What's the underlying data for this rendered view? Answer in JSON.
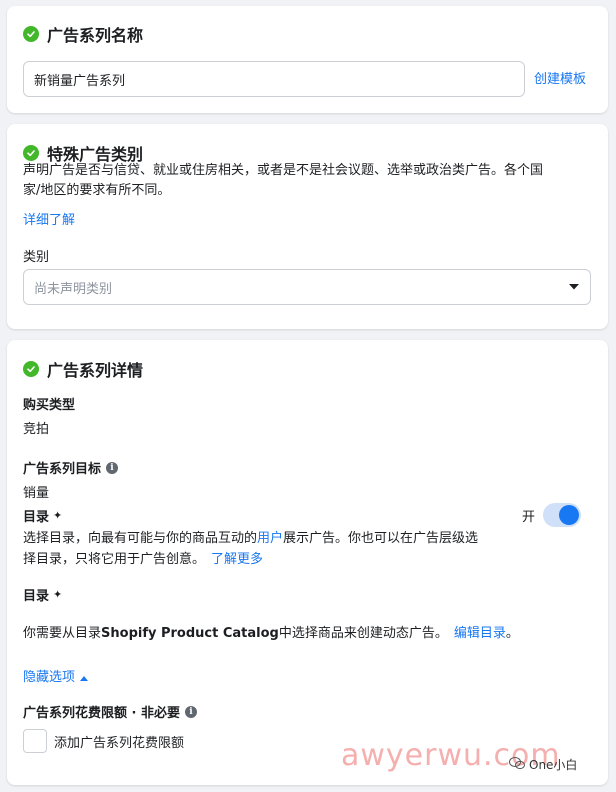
{
  "campaign_name_section": {
    "title": "广告系列名称",
    "input_value": "新销量广告系列",
    "template_link": "创建模板"
  },
  "special_category_section": {
    "title": "特殊广告类别",
    "description_line1": "声明广告是否与信贷、就业或住房相关，或者是不是社会议题、选举或政治类广告。各个国",
    "description_line2": "家/地区的要求有所不同。",
    "learn_more": "详细了解",
    "category_label": "类别",
    "category_placeholder": "尚未声明类别"
  },
  "details_section": {
    "title": "广告系列详情",
    "buying_type_label": "购买类型",
    "buying_type_value": "竞拍",
    "objective_label": "广告系列目标",
    "objective_value": "销量",
    "catalog_label": "目录",
    "catalog_toggle_label": "开",
    "catalog_toggle_on": true,
    "catalog_desc_line1_a": "选择目录，向最有可能与你的商品互动的",
    "catalog_desc_line1_link": "用户",
    "catalog_desc_line1_b": "展示广告。你也可以在广告层级选",
    "catalog_desc_line2": "择目录，只将它用于广告创意。",
    "catalog_learn_more": "了解更多",
    "catalog2_label": "目录",
    "catalog2_desc_a": "你需要从目录",
    "catalog2_desc_bold": "Shopify Product Catalog",
    "catalog2_desc_b": "中选择商品来创建动态广告。",
    "catalog2_edit_link": "编辑目录",
    "catalog2_period": "。",
    "hide_options": "隐藏选项",
    "spend_limit_label": "广告系列花费限额 · 非必要",
    "add_spend_limit": "添加广告系列花费限额"
  },
  "watermark": {
    "text": "awyerwu.com",
    "badge": "One小白"
  },
  "colors": {
    "accent": "#1877f2",
    "success": "#42b72a",
    "watermark": "#f4a7a7"
  }
}
